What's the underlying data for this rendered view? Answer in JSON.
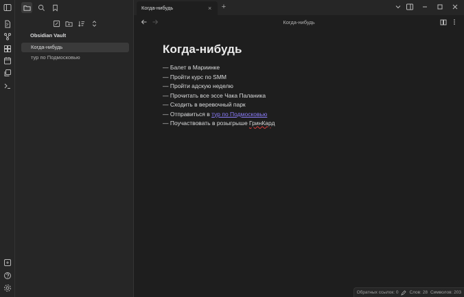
{
  "ribbon": {
    "top_icons": [
      "sidebar-toggle-icon",
      "files-icon",
      "graph-icon",
      "canvas-icon",
      "calendar-icon",
      "copy-icon",
      "terminal-icon"
    ],
    "bottom_icons": [
      "vault-switch-icon",
      "help-icon",
      "settings-icon"
    ]
  },
  "sidebar": {
    "vault_name": "Obsidian Vault",
    "files": [
      {
        "label": "Когда-нибудь",
        "active": true
      },
      {
        "label": "тур по Подмосковью",
        "active": false
      }
    ]
  },
  "tab": {
    "label": "Когда-нибудь",
    "close": "×",
    "new": "+"
  },
  "view": {
    "title": "Когда-нибудь"
  },
  "note": {
    "heading": "Когда-нибудь",
    "lines": [
      "— Балет в Мариинке",
      "— Пройти курс по SMM",
      "— Пройти адскую неделю",
      "— Прочитать все эссе Чака Паланика",
      "— Сходить в веревочный парк"
    ],
    "link_line_prefix": "— Отправиться в ",
    "link_text": "тур по Подмосковью",
    "last_line_prefix": "— Поучаствовать в розыгрыше ",
    "last_line_word": "ГринКард"
  },
  "status": {
    "backlinks": "Обратных ссылок: 0",
    "words": "Слов: 28",
    "chars": "Символов: 203"
  }
}
